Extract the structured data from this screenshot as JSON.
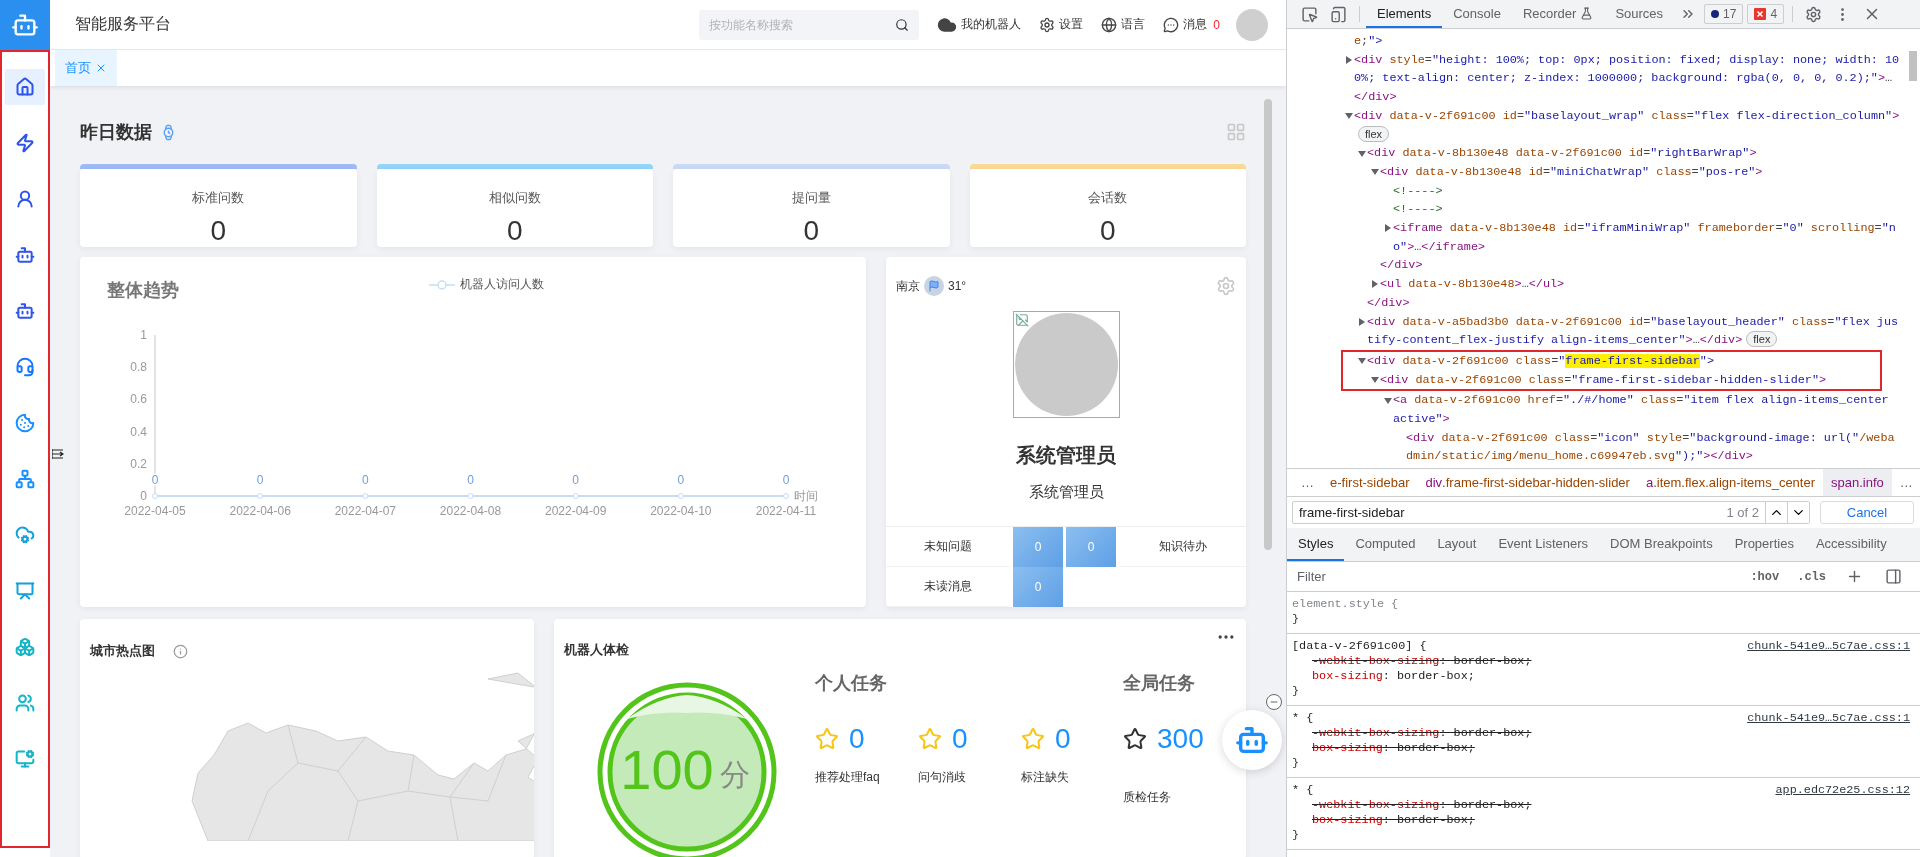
{
  "sidebar": {
    "items": [
      {
        "selected": true
      },
      {
        "selected": false
      },
      {
        "selected": false
      },
      {
        "selected": false
      },
      {
        "selected": false
      },
      {
        "selected": false
      },
      {
        "selected": false
      },
      {
        "selected": false
      },
      {
        "selected": false
      },
      {
        "selected": false
      },
      {
        "selected": false
      },
      {
        "selected": false
      },
      {
        "selected": false
      }
    ]
  },
  "header": {
    "title": "智能服务平台",
    "search": {
      "placeholder": "按功能名称搜索"
    },
    "actions": [
      {
        "label": "我的机器人"
      },
      {
        "label": "设置"
      },
      {
        "label": "语言"
      },
      {
        "label": "消息",
        "count": "0"
      }
    ]
  },
  "tabs": [
    {
      "label": "首页",
      "selected": true
    }
  ],
  "yesterday": {
    "title": "昨日数据",
    "cards": [
      {
        "label": "标准问数",
        "value": "0",
        "color": "#9dbaf6"
      },
      {
        "label": "相似问数",
        "value": "0",
        "color": "#93d4f8"
      },
      {
        "label": "提问量",
        "value": "0",
        "color": "#c9daf6"
      },
      {
        "label": "会话数",
        "value": "0",
        "color": "#fad995"
      }
    ]
  },
  "trend": {
    "chart_data": {
      "type": "line",
      "title": "整体趋势",
      "xlabel": "时间",
      "categories": [
        "2022-04-05",
        "2022-04-06",
        "2022-04-07",
        "2022-04-08",
        "2022-04-09",
        "2022-04-10",
        "2022-04-11"
      ],
      "series": [
        {
          "name": "机器人访问人数",
          "color": "#c9dcf2",
          "marker": "circle",
          "values": [
            0,
            0,
            0,
            0,
            0,
            0,
            0
          ]
        }
      ],
      "ylim": [
        0,
        1
      ],
      "yticks": [
        0,
        0.2,
        0.4,
        0.6,
        0.8,
        1
      ],
      "data_labels": true
    }
  },
  "profile": {
    "city": "南京",
    "temperature": "31°",
    "name": "系统管理员",
    "role": "系统管理员",
    "rows": [
      {
        "label": "未知问题",
        "values": [
          "0",
          "0"
        ],
        "trailing": "知识待办"
      },
      {
        "label": "未读消息",
        "values": [
          "0"
        ]
      }
    ]
  },
  "city_map": {
    "title": "城市热点图"
  },
  "health": {
    "title": "机器人体检",
    "score": "100",
    "unit": "分",
    "personal": {
      "title": "个人任务",
      "items": [
        {
          "value": "0",
          "label": "推荐处理faq"
        },
        {
          "value": "0",
          "label": "问句消歧"
        },
        {
          "value": "0",
          "label": "标注缺失"
        }
      ]
    },
    "global": {
      "title": "全局任务",
      "items": [
        {
          "value": "300",
          "label": "质检任务"
        }
      ]
    }
  },
  "devtools": {
    "tabs": [
      {
        "label": "Elements",
        "selected": true
      },
      {
        "label": "Console",
        "selected": false
      },
      {
        "label": "Recorder",
        "selected": false
      },
      {
        "label": "Sources",
        "selected": false
      }
    ],
    "issues": "17",
    "errors": "4",
    "tree": [
      {
        "text": "e;\">",
        "boxed": false
      },
      {
        "text": "<div style=\"height: 100%; top: 0px; position: fixed; display: none; width: 100%; text-align: center; z-index: 1000000; background: rgba(0, 0, 0, 0.2);\">…</div>",
        "expanded": false,
        "boxed": false
      },
      {
        "text": "<div data-v-2f691c00 id=\"baselayout_wrap\" class=\"flex flex-direction_column\">",
        "badge": "flex",
        "expanded": true,
        "boxed": false,
        "children": [
          {
            "text": "<div data-v-8b130e48 data-v-2f691c00 id=\"rightBarWrap\">",
            "expanded": true,
            "boxed": false,
            "close": "</div>",
            "children": [
              {
                "text": "<div data-v-8b130e48 id=\"miniChatWrap\" class=\"pos-re\">",
                "expanded": true,
                "boxed": false,
                "close": "</div>",
                "children": [
                  {
                    "text": "<!---->",
                    "boxed": false
                  },
                  {
                    "text": "<!---->",
                    "boxed": false
                  },
                  {
                    "text": "<iframe data-v-8b130e48 id=\"iframMiniWrap\" frameborder=\"0\" scrolling=\"no\">…</iframe>",
                    "expanded": false,
                    "boxed": false
                  }
                ]
              },
              {
                "text": "<ul data-v-8b130e48>…</ul>",
                "expanded": false,
                "boxed": false
              }
            ]
          },
          {
            "text": "<div data-v-a5bad3b0 data-v-2f691c00 id=\"baselayout_header\" class=\"flex justify-content_flex-justify align-items_center\">…</div>",
            "badge": "flex",
            "expanded": false,
            "boxed": false
          },
          {
            "text": "<div data-v-2f691c00 class=\"",
            "match": "frame-first-sidebar",
            "after": "\">",
            "expanded": true,
            "boxed": true,
            "children": [
              {
                "text": "<div data-v-2f691c00 class=\"frame-first-sidebar-hidden-slider\">",
                "expanded": true,
                "boxed": true,
                "children": [
                  {
                    "text": "<a data-v-2f691c00 href=\"./#/home\" class=\"item flex align-items_center active\">",
                    "expanded": true,
                    "boxed": false,
                    "children": [
                      {
                        "text": "<div data-v-2f691c00 class=\"icon\" style=\"background-image: url(\"/webadmin/static/img/menu_home.c69947eb.svg\");\"></div>",
                        "boxed": false
                      }
                    ]
                  }
                ]
              }
            ]
          }
        ]
      }
    ],
    "breadcrumbs": {
      "before": "…",
      "items": [
        {
          "text": "e-first-sidebar",
          "selected": false
        },
        {
          "text": "div.frame-first-sidebar-hidden-slider",
          "selected": false
        },
        {
          "text": "a.item.flex.align-items_center",
          "selected": false
        },
        {
          "text": "span.info",
          "selected": true
        }
      ],
      "after": "…"
    },
    "find": {
      "value": "frame-first-sidebar",
      "count": "1 of 2",
      "cancel": "Cancel"
    },
    "panel_tabs": [
      {
        "label": "Styles",
        "selected": true
      },
      {
        "label": "Computed",
        "selected": false
      },
      {
        "label": "Layout",
        "selected": false
      },
      {
        "label": "Event Listeners",
        "selected": false
      },
      {
        "label": "DOM Breakpoints",
        "selected": false
      },
      {
        "label": "Properties",
        "selected": false
      },
      {
        "label": "Accessibility",
        "selected": false
      }
    ],
    "filter": {
      "placeholder": "Filter",
      "tools": [
        ":hov",
        ".cls"
      ]
    },
    "rules": [
      {
        "kind": "inline",
        "selector": "element.style {",
        "close": "}"
      },
      {
        "kind": "rule",
        "selector": "[data-v-2f691c00] {",
        "source": "chunk-541e9…5c7ae.css:1",
        "close": "}",
        "props": [
          {
            "text": "-webkit-box-sizing: border-box;",
            "struck": true
          },
          {
            "text": "box-sizing: border-box;",
            "struck": false
          }
        ]
      },
      {
        "kind": "rule",
        "selector": "* {",
        "source": "chunk-541e9…5c7ae.css:1",
        "close": "}",
        "props": [
          {
            "text": "-webkit-box-sizing: border-box;",
            "struck": true
          },
          {
            "text": "box-sizing: border-box;",
            "struck": true
          }
        ]
      },
      {
        "kind": "rule",
        "selector": "* {",
        "source": "app.edc72e25.css:12",
        "close": "}",
        "props": [
          {
            "text": "-webkit-box-sizing: border-box;",
            "struck": true
          },
          {
            "text": "box-sizing: border-box;",
            "struck": true
          }
        ]
      }
    ]
  }
}
